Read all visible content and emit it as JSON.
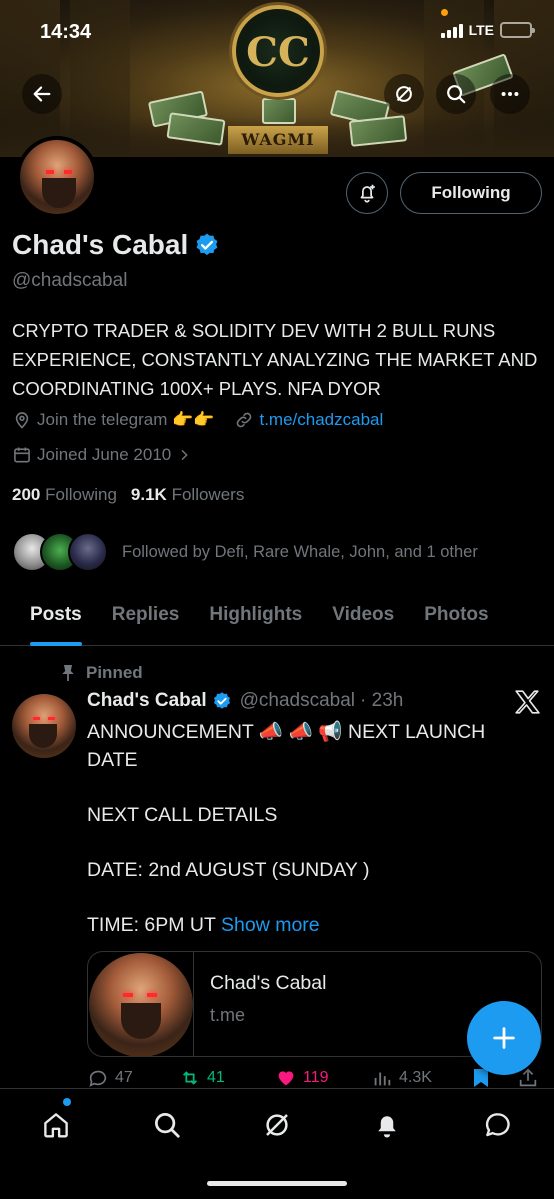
{
  "status_bar": {
    "time": "14:34",
    "network": "LTE"
  },
  "banner": {
    "logo_letters": "CC",
    "banner_text": "WAGMI"
  },
  "header_buttons": {
    "back": "back-arrow-icon",
    "grok": "grok-icon",
    "search": "search-icon",
    "more": "more-dots-icon"
  },
  "profile": {
    "display_name": "Chad's Cabal",
    "handle": "@chadscabal",
    "bio": "CRYPTO TRADER & SOLIDITY DEV WITH 2 BULL RUNS EXPERIENCE, CONSTANTLY ANALYZING THE MARKET AND COORDINATING 100X+ PLAYS. NFA DYOR",
    "location": "Join the telegram 👉👉",
    "website": "t.me/chadzcabal",
    "joined": "Joined June 2010",
    "following_count": "200",
    "following_label": "Following",
    "followers_count": "9.1K",
    "followers_label": "Followers",
    "followed_by": "Followed by Defi, Rare Whale, John, and 1 other",
    "follow_button": "Following",
    "verified_color": "#1d9bf0"
  },
  "tabs": [
    {
      "label": "Posts",
      "active": true
    },
    {
      "label": "Replies"
    },
    {
      "label": "Highlights"
    },
    {
      "label": "Videos"
    },
    {
      "label": "Photos"
    }
  ],
  "pinned_post": {
    "pinned_label": "Pinned",
    "author": "Chad's Cabal",
    "handle": "@chadscabal",
    "time": "· 23h",
    "line1": "ANNOUNCEMENT 📣 📣 📢 NEXT LAUNCH DATE",
    "line2": "NEXT CALL DETAILS",
    "line3": "DATE: 2nd AUGUST (SUNDAY )",
    "line4": "TIME: 6PM UT",
    "show_more": "Show more",
    "card_title": "Chad's Cabal",
    "card_domain": "t.me",
    "replies": "47",
    "reposts": "41",
    "likes": "119",
    "views": "4.3K"
  },
  "colors": {
    "accent": "#1d9bf0",
    "repost": "#00ba7c",
    "like": "#f91880",
    "muted": "#71767b"
  },
  "bottom_nav": [
    "home-icon",
    "search-icon",
    "grok-icon",
    "notifications-bell-icon",
    "messages-icon"
  ]
}
